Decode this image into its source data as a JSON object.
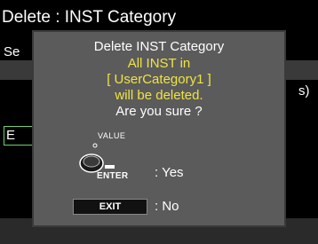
{
  "header": {
    "title": "Delete : INST Category"
  },
  "background": {
    "label_partial": "Se",
    "right_text_partial": "s)",
    "exec_button_partial": "E"
  },
  "dialog": {
    "title": "Delete INST Category",
    "message_line1": "All INST in",
    "message_line2": "[ UserCategory1 ]",
    "message_line3": "will be deleted.",
    "question": "Are you sure ?",
    "value_label": "VALUE",
    "enter_label": "ENTER",
    "yes_label": ": Yes",
    "exit_button": "EXIT",
    "no_label": ": No"
  },
  "colors": {
    "dialog_bg": "#5b5b5b",
    "highlight_text": "#f0e442",
    "exec_border": "#6fcf6f"
  },
  "icons": {
    "knob": "value-dial-icon",
    "enter": "enter-button-icon"
  }
}
